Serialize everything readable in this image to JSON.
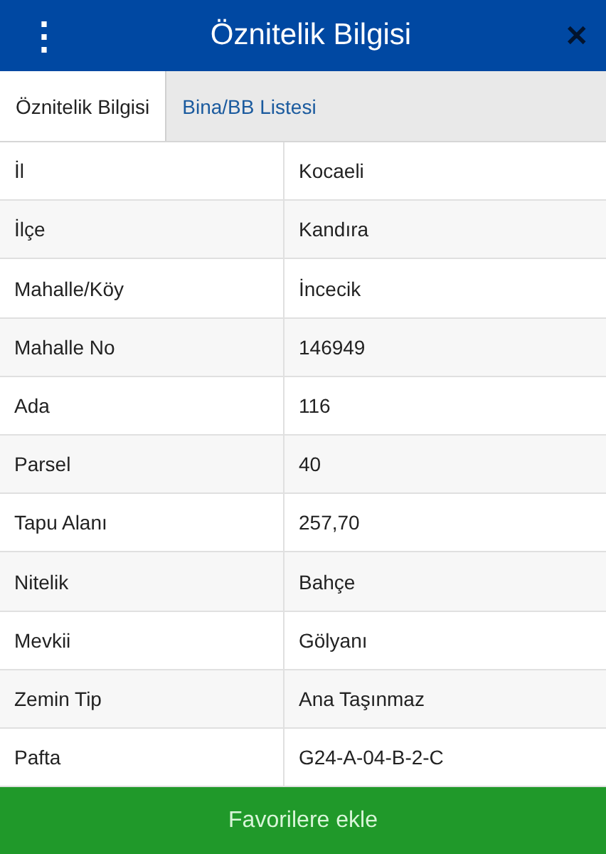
{
  "header": {
    "title": "Öznitelik Bilgisi",
    "menu_icon": "⋮",
    "close_icon": "✕"
  },
  "tabs": [
    {
      "label": "Öznitelik Bilgisi",
      "selected": true
    },
    {
      "label": "Bina/BB Listesi",
      "selected": false
    }
  ],
  "rows": [
    {
      "label": "İl",
      "value": "Kocaeli"
    },
    {
      "label": "İlçe",
      "value": "Kandıra"
    },
    {
      "label": "Mahalle/Köy",
      "value": "İncecik"
    },
    {
      "label": "Mahalle No",
      "value": "146949"
    },
    {
      "label": "Ada",
      "value": "116"
    },
    {
      "label": "Parsel",
      "value": "40"
    },
    {
      "label": "Tapu Alanı",
      "value": "257,70"
    },
    {
      "label": "Nitelik",
      "value": "Bahçe"
    },
    {
      "label": "Mevkii",
      "value": "Gölyanı"
    },
    {
      "label": "Zemin Tip",
      "value": "Ana Taşınmaz"
    },
    {
      "label": "Pafta",
      "value": "G24-A-04-B-2-C"
    }
  ],
  "footer_button": "Favorilere ekle"
}
